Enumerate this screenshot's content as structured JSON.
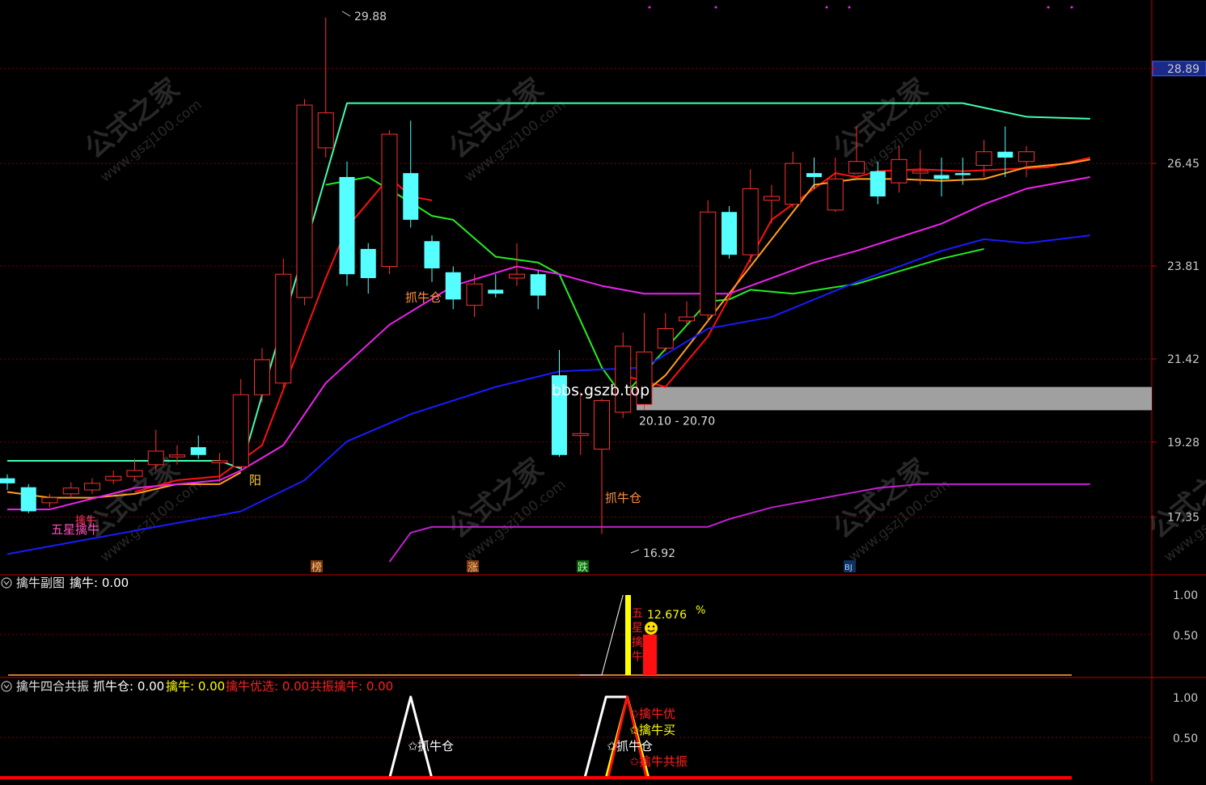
{
  "colors": {
    "bg": "#000000",
    "frame": "#c00000",
    "grid": "#7a0000",
    "up": "#ff3030",
    "down": "#55ffff",
    "axis_text": "#c8c8c8",
    "top_line": "#40ffb0",
    "green_line": "#22ee22",
    "red_line": "#ff1010",
    "orange_line": "#ffa020",
    "magenta": "#ee22ee",
    "blue": "#1a1aff",
    "purple": "#c020d0",
    "yellow": "#ffff00",
    "white": "#ffffff",
    "gray_zone": "#a0a0a0"
  },
  "icons": {
    "indicator_toggle": "circle-chevron-down-icon",
    "smiley": "smiley-icon",
    "star": "star-icon"
  },
  "main_panel": {
    "price_axis": {
      "ticks": [
        28.89,
        26.45,
        23.81,
        21.42,
        19.28,
        17.35
      ],
      "highlight_tick": "28.89",
      "ylim": [
        16.2,
        30.3
      ]
    },
    "watermark_url": "www.gszj100.com",
    "watermark_brand": "公式之家",
    "overlay_text": "bbs.gszb.top",
    "zone": {
      "label": "20.10 - 20.70",
      "low": 20.1,
      "high": 20.7
    },
    "high_marker": "29.88",
    "low_marker": "16.92",
    "labels": {
      "wuxing": "五星擒牛",
      "qinniu_small": "擒牛",
      "yang": "阳",
      "zhuaniucang_1": "抓牛仓",
      "zhuaniucang_2": "抓牛仓",
      "bang": "榜",
      "zhang": "涨",
      "die": "跌",
      "badge4": "BJ"
    }
  },
  "sub1": {
    "title": "擒牛副图",
    "value_label": "擒牛: 0.00",
    "ticks": [
      "1.00",
      "0.50"
    ],
    "pct_value": "12.676",
    "pct_sign": "%",
    "vertical_text": [
      "五",
      "星",
      "擒",
      "牛"
    ]
  },
  "sub2": {
    "title": "擒牛四合共振",
    "legend": [
      {
        "text": "抓牛仓: 0.00",
        "color": "#ffffff"
      },
      {
        "text": "擒牛: 0.00",
        "color": "#ffff00"
      },
      {
        "text": "擒牛优选: 0.00",
        "color": "#ff2020"
      },
      {
        "text": "共振擒牛: 0.00",
        "color": "#ff2020"
      }
    ],
    "ticks": [
      "1.00",
      "0.50"
    ],
    "labels": {
      "zhuaniucang_a": "抓牛仓",
      "zhuaniucang_b": "抓牛仓",
      "qinniuyou": "擒牛优",
      "qinniumai": "擒牛买",
      "qinniugongzhen": "擒牛共振"
    }
  },
  "chart_data": [
    {
      "type": "candlestick",
      "series": [
        {
          "name": "",
          "values": [
            {
              "o": 18.35,
              "c": 18.22,
              "h": 18.45,
              "l": 18.05
            },
            {
              "o": 18.12,
              "c": 17.5,
              "h": 18.2,
              "l": 17.45
            },
            {
              "o": 17.72,
              "c": 17.85,
              "h": 17.95,
              "l": 17.6
            },
            {
              "o": 17.95,
              "c": 18.1,
              "h": 18.25,
              "l": 17.85
            },
            {
              "o": 18.05,
              "c": 18.22,
              "h": 18.35,
              "l": 17.95
            },
            {
              "o": 18.3,
              "c": 18.4,
              "h": 18.55,
              "l": 18.2
            },
            {
              "o": 18.4,
              "c": 18.55,
              "h": 18.85,
              "l": 18.3
            },
            {
              "o": 18.7,
              "c": 19.05,
              "h": 19.6,
              "l": 18.55
            },
            {
              "o": 18.9,
              "c": 18.95,
              "h": 19.2,
              "l": 18.7
            },
            {
              "o": 19.15,
              "c": 18.95,
              "h": 19.45,
              "l": 18.85
            },
            {
              "o": 18.75,
              "c": 18.8,
              "h": 19.0,
              "l": 18.25
            },
            {
              "o": 18.65,
              "c": 20.5,
              "h": 20.9,
              "l": 18.55
            },
            {
              "o": 20.5,
              "c": 21.4,
              "h": 21.7,
              "l": 20.3
            },
            {
              "o": 20.8,
              "c": 23.6,
              "h": 24.0,
              "l": 20.7
            },
            {
              "o": 23.0,
              "c": 27.95,
              "h": 28.1,
              "l": 22.8
            },
            {
              "o": 26.85,
              "c": 27.75,
              "h": 30.2,
              "l": 26.6
            },
            {
              "o": 26.1,
              "c": 23.6,
              "h": 26.5,
              "l": 23.3
            },
            {
              "o": 24.25,
              "c": 23.5,
              "h": 24.4,
              "l": 23.1
            },
            {
              "o": 23.8,
              "c": 27.2,
              "h": 27.3,
              "l": 23.6
            },
            {
              "o": 26.2,
              "c": 25.0,
              "h": 27.55,
              "l": 24.8
            },
            {
              "o": 24.45,
              "c": 23.75,
              "h": 24.6,
              "l": 23.4
            },
            {
              "o": 23.65,
              "c": 22.95,
              "h": 23.8,
              "l": 22.7
            },
            {
              "o": 22.8,
              "c": 23.35,
              "h": 23.6,
              "l": 22.5
            },
            {
              "o": 23.2,
              "c": 23.1,
              "h": 23.6,
              "l": 23.0
            },
            {
              "o": 23.5,
              "c": 23.6,
              "h": 24.4,
              "l": 23.3
            },
            {
              "o": 23.6,
              "c": 23.05,
              "h": 23.7,
              "l": 22.7
            },
            {
              "o": 21.0,
              "c": 18.95,
              "h": 21.65,
              "l": 18.9
            },
            {
              "o": 19.45,
              "c": 19.5,
              "h": 20.55,
              "l": 18.95
            },
            {
              "o": 19.1,
              "c": 20.35,
              "h": 20.4,
              "l": 16.92
            },
            {
              "o": 20.05,
              "c": 21.75,
              "h": 22.1,
              "l": 19.9
            },
            {
              "o": 20.25,
              "c": 21.6,
              "h": 22.6,
              "l": 20.1
            },
            {
              "o": 21.7,
              "c": 22.2,
              "h": 22.6,
              "l": 21.6
            },
            {
              "o": 22.4,
              "c": 22.5,
              "h": 22.9,
              "l": 22.3
            },
            {
              "o": 22.55,
              "c": 25.2,
              "h": 25.5,
              "l": 22.4
            },
            {
              "o": 25.2,
              "c": 24.1,
              "h": 25.35,
              "l": 24.0
            },
            {
              "o": 24.1,
              "c": 25.8,
              "h": 26.3,
              "l": 23.9
            },
            {
              "o": 25.5,
              "c": 25.6,
              "h": 25.9,
              "l": 24.9
            },
            {
              "o": 25.4,
              "c": 26.45,
              "h": 26.75,
              "l": 25.3
            },
            {
              "o": 26.2,
              "c": 26.1,
              "h": 26.6,
              "l": 25.8
            },
            {
              "o": 25.25,
              "c": 26.05,
              "h": 26.6,
              "l": 25.2
            },
            {
              "o": 26.2,
              "c": 26.5,
              "h": 27.4,
              "l": 26.2
            },
            {
              "o": 26.25,
              "c": 25.6,
              "h": 26.5,
              "l": 25.4
            },
            {
              "o": 25.95,
              "c": 26.55,
              "h": 26.9,
              "l": 25.7
            },
            {
              "o": 26.2,
              "c": 26.25,
              "h": 26.8,
              "l": 25.9
            },
            {
              "o": 26.15,
              "c": 26.05,
              "h": 26.6,
              "l": 25.6
            },
            {
              "o": 26.2,
              "c": 26.15,
              "h": 26.6,
              "l": 25.9
            },
            {
              "o": 26.4,
              "c": 26.75,
              "h": 27.05,
              "l": 26.1
            },
            {
              "o": 26.75,
              "c": 26.6,
              "h": 27.4,
              "l": 26.1
            },
            {
              "o": 26.5,
              "c": 26.75,
              "h": 26.9,
              "l": 26.1
            }
          ]
        }
      ],
      "overlays": [
        {
          "name": "",
          "color": "#40ffb0",
          "values": [
            [
              0,
              18.8
            ],
            [
              10,
              18.8
            ],
            [
              11,
              18.6
            ],
            [
              16,
              28.0
            ],
            [
              45,
              28.0
            ],
            [
              48,
              27.65
            ],
            [
              51,
              27.6
            ]
          ]
        },
        {
          "name": "",
          "color": "#22ee22",
          "values": [
            [
              15,
              25.9
            ],
            [
              17,
              26.1
            ],
            [
              19,
              25.45
            ],
            [
              20,
              25.1
            ],
            [
              21,
              25.0
            ],
            [
              23,
              24.05
            ],
            [
              25,
              23.9
            ],
            [
              26,
              23.6
            ],
            [
              28,
              21.2
            ],
            [
              29,
              20.45
            ],
            [
              33,
              22.9
            ],
            [
              34,
              22.95
            ],
            [
              35,
              23.2
            ],
            [
              37,
              23.1
            ],
            [
              40,
              23.35
            ],
            [
              44,
              24.0
            ],
            [
              46,
              24.25
            ]
          ]
        },
        {
          "name": "",
          "color": "#ff1010",
          "values": [
            [
              6,
              18.0
            ],
            [
              8,
              18.3
            ],
            [
              10,
              18.4
            ],
            [
              12,
              19.2
            ],
            [
              15,
              23.5
            ],
            [
              16,
              24.8
            ],
            [
              18,
              26.1
            ],
            [
              19,
              25.6
            ],
            [
              20,
              25.5
            ]
          ]
        },
        {
          "name": "",
          "color": "#ff1010",
          "values": [
            [
              29,
              21.0
            ],
            [
              31,
              20.7
            ],
            [
              33,
              22.0
            ],
            [
              35,
              24.0
            ],
            [
              36,
              25.0
            ],
            [
              39,
              26.2
            ],
            [
              40,
              26.1
            ],
            [
              41,
              26.25
            ],
            [
              43,
              26.3
            ],
            [
              45,
              26.25
            ],
            [
              47,
              26.3
            ],
            [
              49,
              26.35
            ],
            [
              51,
              26.6
            ]
          ]
        },
        {
          "name": "",
          "color": "#ffa020",
          "values": [
            [
              0,
              18.0
            ],
            [
              2,
              17.85
            ],
            [
              4,
              17.85
            ],
            [
              6,
              17.95
            ],
            [
              8,
              18.2
            ],
            [
              10,
              18.2
            ],
            [
              11,
              18.5
            ]
          ]
        },
        {
          "name": "",
          "color": "#ffa020",
          "values": [
            [
              30,
              20.55
            ],
            [
              31,
              21.0
            ],
            [
              38,
              25.9
            ],
            [
              40,
              26.05
            ],
            [
              42,
              26.05
            ],
            [
              44,
              26.0
            ],
            [
              46,
              26.05
            ],
            [
              48,
              26.35
            ],
            [
              50,
              26.45
            ],
            [
              51,
              26.55
            ]
          ]
        },
        {
          "name": "",
          "color": "#ee22ee",
          "values": [
            [
              0,
              17.55
            ],
            [
              2,
              17.55
            ],
            [
              6,
              18.1
            ],
            [
              8,
              18.2
            ],
            [
              10,
              18.3
            ],
            [
              11,
              18.55
            ],
            [
              13,
              19.2
            ],
            [
              15,
              20.8
            ],
            [
              18,
              22.3
            ],
            [
              21,
              23.3
            ],
            [
              24,
              23.8
            ],
            [
              26,
              23.6
            ],
            [
              28,
              23.3
            ],
            [
              30,
              23.1
            ],
            [
              34,
              23.1
            ],
            [
              36,
              23.5
            ],
            [
              38,
              23.9
            ],
            [
              40,
              24.2
            ],
            [
              44,
              24.9
            ],
            [
              46,
              25.4
            ],
            [
              48,
              25.8
            ],
            [
              51,
              26.1
            ]
          ]
        },
        {
          "name": "",
          "color": "#1a1aff",
          "values": [
            [
              0,
              16.4
            ],
            [
              4,
              16.8
            ],
            [
              8,
              17.2
            ],
            [
              11,
              17.5
            ],
            [
              14,
              18.3
            ],
            [
              16,
              19.3
            ],
            [
              19,
              20.0
            ],
            [
              23,
              20.7
            ],
            [
              26,
              21.1
            ],
            [
              30,
              21.2
            ],
            [
              33,
              22.2
            ],
            [
              36,
              22.5
            ],
            [
              40,
              23.4
            ],
            [
              44,
              24.2
            ],
            [
              46,
              24.5
            ],
            [
              48,
              24.4
            ],
            [
              51,
              24.6
            ]
          ]
        },
        {
          "name": "",
          "color": "#c020d0",
          "values": [
            [
              18,
              16.2
            ],
            [
              19,
              16.95
            ],
            [
              20,
              17.1
            ],
            [
              33,
              17.1
            ],
            [
              34,
              17.3
            ],
            [
              36,
              17.6
            ],
            [
              38,
              17.8
            ],
            [
              40,
              18.0
            ],
            [
              41,
              18.1
            ],
            [
              43,
              18.2
            ],
            [
              51,
              18.2
            ]
          ]
        }
      ],
      "ylim": [
        16.2,
        30.3
      ]
    },
    {
      "type": "line",
      "title": "擒牛副图",
      "series": [
        {
          "name": "擒牛",
          "values": [
            [
              0,
              0
            ],
            [
              28,
              0
            ],
            [
              29,
              1
            ],
            [
              30,
              0
            ],
            [
              51,
              0
            ]
          ]
        }
      ],
      "ylim": [
        0,
        1.1
      ]
    },
    {
      "type": "line",
      "title": "擒牛四合共振",
      "series": [
        {
          "name": "抓牛仓",
          "values": [
            [
              0,
              0
            ],
            [
              18,
              0
            ],
            [
              19,
              1
            ],
            [
              20,
              0
            ],
            [
              27,
              0
            ],
            [
              28,
              1
            ],
            [
              29,
              1
            ],
            [
              30,
              0
            ],
            [
              51,
              0
            ]
          ]
        },
        {
          "name": "擒牛",
          "values": [
            [
              0,
              0
            ],
            [
              28,
              0
            ],
            [
              29,
              1
            ],
            [
              30,
              0
            ],
            [
              51,
              0
            ]
          ]
        },
        {
          "name": "擒牛优选",
          "values": [
            [
              0,
              0
            ],
            [
              28,
              0
            ],
            [
              29,
              1
            ],
            [
              30,
              0
            ],
            [
              51,
              0
            ]
          ]
        },
        {
          "name": "共振擒牛",
          "values": [
            [
              0,
              0
            ],
            [
              51,
              0
            ]
          ]
        }
      ],
      "ylim": [
        0,
        1.1
      ]
    }
  ]
}
